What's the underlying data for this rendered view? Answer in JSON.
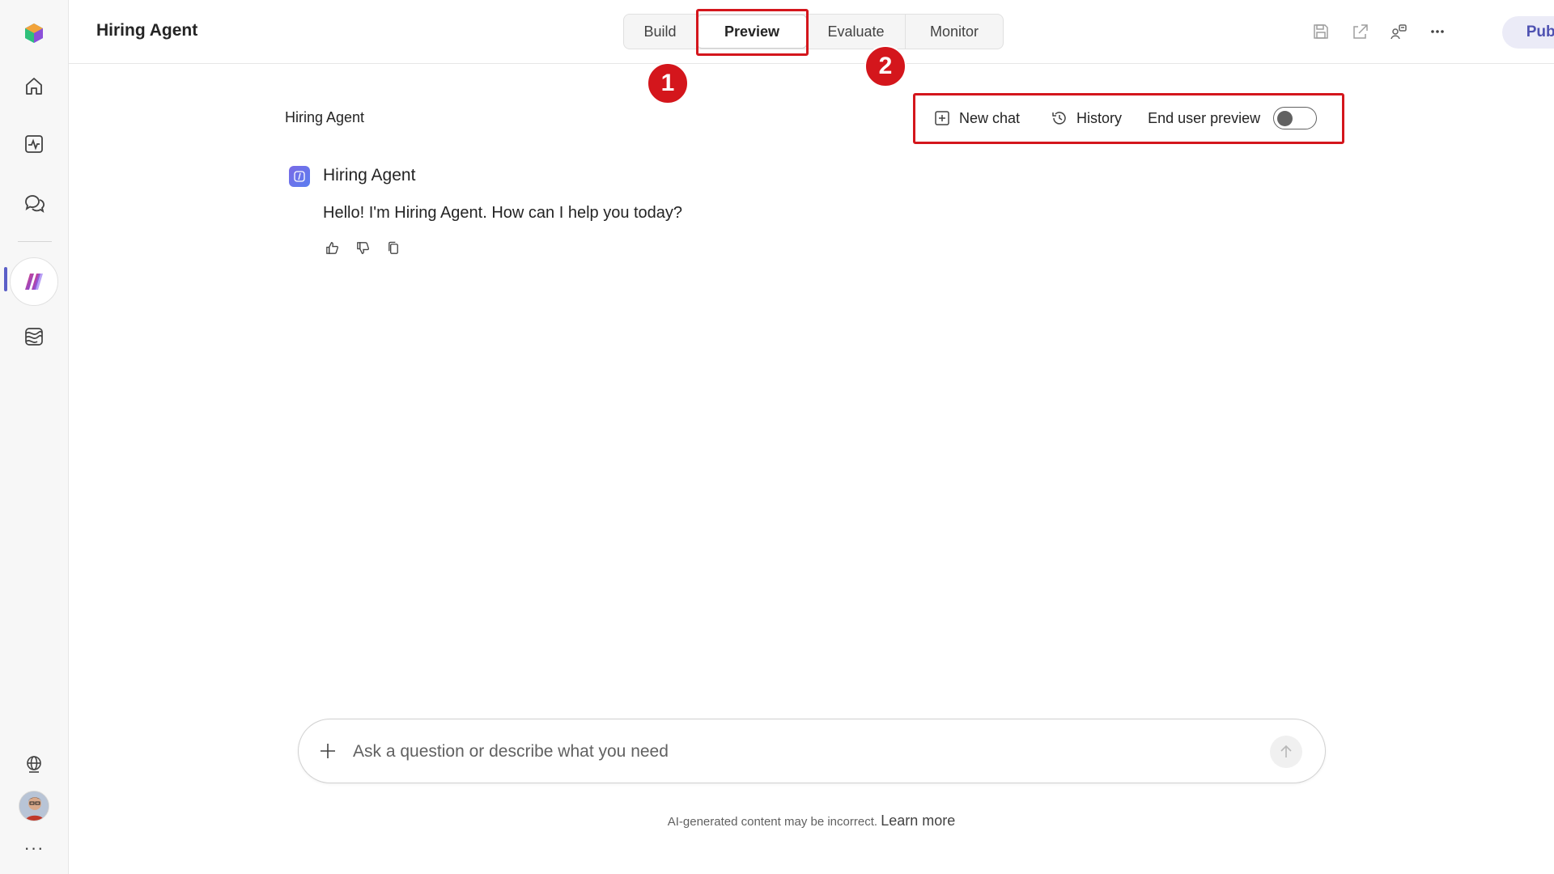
{
  "header": {
    "app_title": "Hiring Agent",
    "tabs": [
      {
        "label": "Build"
      },
      {
        "label": "Preview"
      },
      {
        "label": "Evaluate"
      },
      {
        "label": "Monitor"
      }
    ],
    "active_tab": "Preview",
    "publish_label": "Publish",
    "icons": [
      "save-icon",
      "share-icon",
      "connect-icon",
      "more-icon"
    ]
  },
  "callouts": {
    "badge_1": "1",
    "badge_2": "2",
    "color": "#d4161c"
  },
  "sidebar": {
    "icons": [
      "app-logo-icon",
      "home-icon",
      "analytics-icon",
      "chat-icon",
      "copilot-icon",
      "models-icon",
      "globe-icon",
      "avatar",
      "more-icon"
    ],
    "more_label": "···"
  },
  "chat": {
    "title": "Hiring Agent",
    "new_chat_label": "New chat",
    "history_label": "History",
    "end_user_preview_label": "End user preview",
    "end_user_preview_on": false,
    "message": {
      "sender": "Hiring Agent",
      "text": "Hello! I'm Hiring Agent. How can I help you today?"
    }
  },
  "composer": {
    "placeholder": "Ask a question or describe what you need"
  },
  "footer": {
    "disclaimer": "AI-generated content may be incorrect.",
    "learn_more": "Learn more"
  },
  "colors": {
    "accent": "#5b5fc7",
    "publish_bg": "#ebebf7",
    "publish_text": "#4f52b2"
  }
}
